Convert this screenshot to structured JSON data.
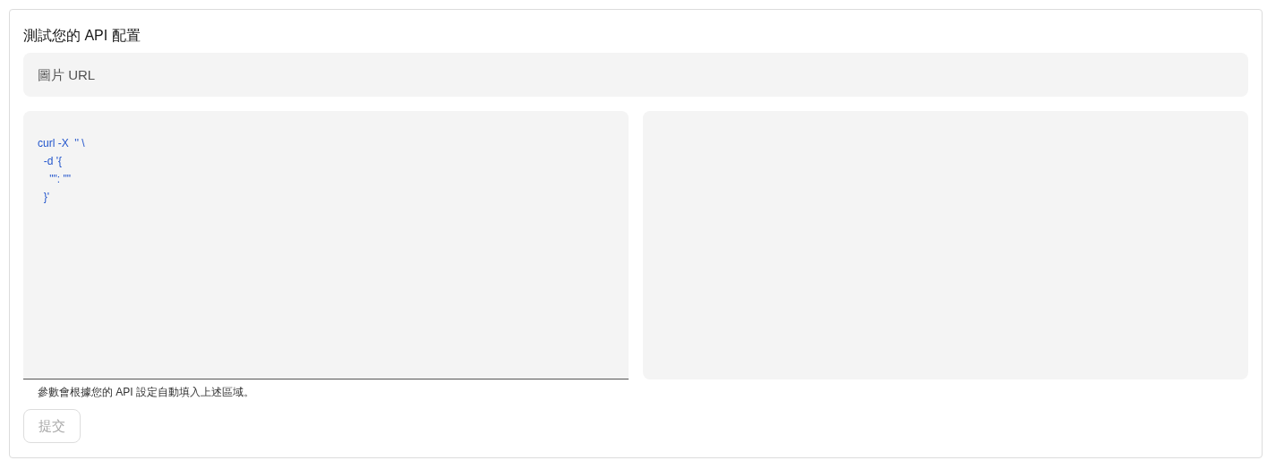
{
  "title": "測試您的 API 配置",
  "url_field": {
    "placeholder": "圖片 URL"
  },
  "code_field": {
    "value": "curl -X  '' \\\n  -d '{\n    \"\": \"\"\n  }'"
  },
  "helper_text": "參數會根據您的 API 設定自動填入上述區域。",
  "submit_button": {
    "label": "提交",
    "disabled": true
  }
}
